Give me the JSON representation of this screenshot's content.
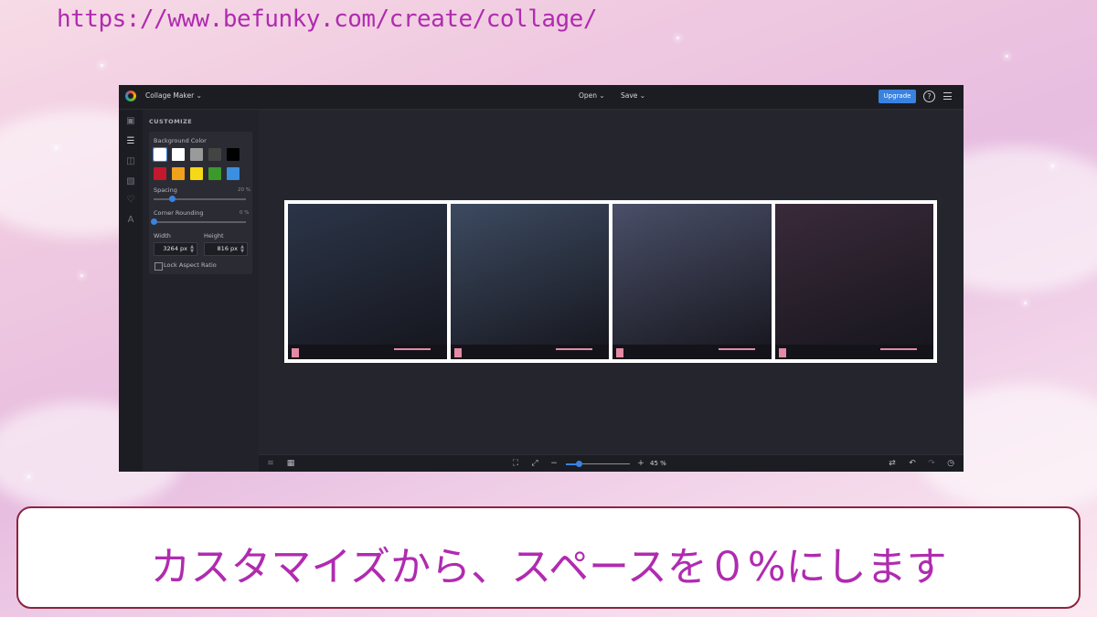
{
  "url": "https://www.befunky.com/create/collage/",
  "app": {
    "title": "Collage Maker",
    "menu_open": "Open",
    "menu_save": "Save",
    "upgrade": "Upgrade",
    "help_glyph": "?"
  },
  "customize": {
    "title": "CUSTOMIZE",
    "background_color_label": "Background Color",
    "swatches": [
      "#ffffff",
      "#ffffff",
      "#9a9a9a",
      "#444444",
      "#000000",
      "#c4182d",
      "#f0a21d",
      "#f6d816",
      "#3c9a2a",
      "#3a8fe0"
    ],
    "spacing_label": "Spacing",
    "spacing_value": "20 %",
    "spacing_level": 0.2,
    "corner_label": "Corner Rounding",
    "corner_value": "0 %",
    "corner_level": 0,
    "width_label": "Width",
    "height_label": "Height",
    "width_value": "3264 px",
    "height_value": "816 px",
    "lock_label": "Lock Aspect Ratio"
  },
  "canvas": {
    "photos": [
      {
        "name": "photo-1",
        "tone": "#2b3548"
      },
      {
        "name": "photo-2",
        "tone": "#3c4a60"
      },
      {
        "name": "photo-3",
        "tone": "#4a4f68"
      },
      {
        "name": "photo-4",
        "tone": "#3a2a3a"
      }
    ]
  },
  "bottom": {
    "zoom_value": "45 %",
    "zoom_level": 0.2
  },
  "caption": "カスタマイズから、スペースを０%にします"
}
